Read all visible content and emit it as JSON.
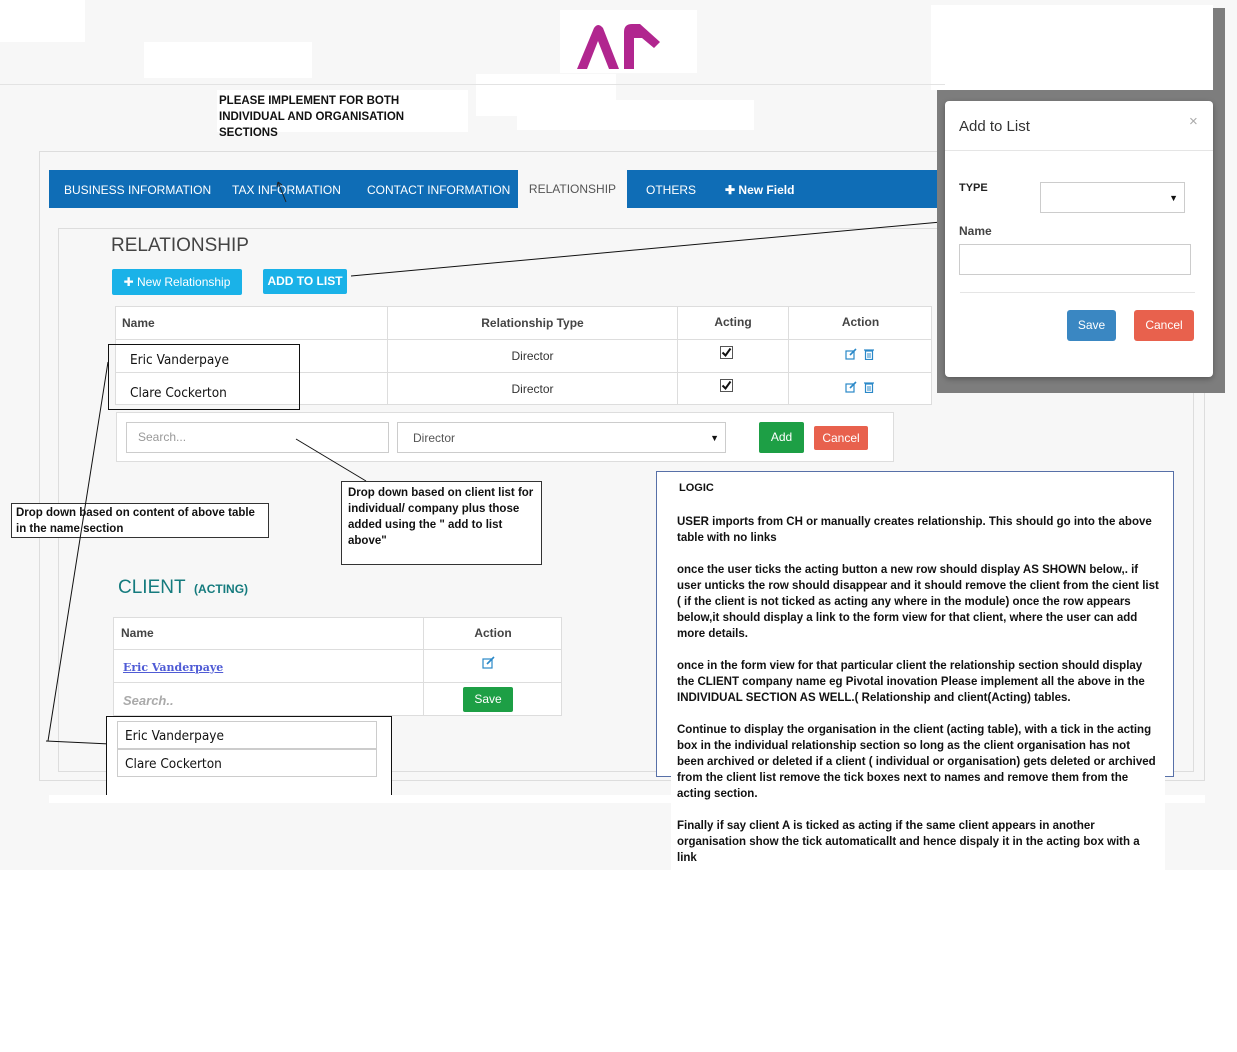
{
  "colors": {
    "nav_bg": "#0f6db6",
    "cyan_button": "#1ab2e8",
    "green": "#1d9f45",
    "red_cancel": "#e8614d",
    "save_blue": "#3a87c2",
    "client_heading": "#157b7e",
    "logo": "#b1268f",
    "link": "#4f5bd5"
  },
  "logo": {
    "alt": "AP"
  },
  "top_note": "PLEASE IMPLEMENT FOR BOTH INDIVIDUAL AND ORGANISATION SECTIONS",
  "tabs": [
    {
      "label": "BUSINESS INFORMATION"
    },
    {
      "label": "TAX INFORMATION"
    },
    {
      "label": "CONTACT INFORMATION"
    },
    {
      "label": "RELATIONSHIP"
    },
    {
      "label": "OTHERS"
    },
    {
      "label": "New Field",
      "icon": "plus-icon"
    }
  ],
  "relationship": {
    "title": "RELATIONSHIP",
    "new_button": "New Relationship",
    "add_list_button": "ADD TO LIST",
    "columns": [
      "Name",
      "Relationship Type",
      "Acting",
      "Action"
    ],
    "rows": [
      {
        "name": "Eric Vanderpaye",
        "type": "Director",
        "acting": true
      },
      {
        "name": "Clare Cockerton",
        "type": "Director",
        "acting": true
      }
    ],
    "add_row": {
      "search_placeholder": "Search...",
      "type_value": "Director",
      "add_label": "Add",
      "cancel_label": "Cancel"
    }
  },
  "notes": {
    "dropdown_name": "Drop down based on content of above table in the name section",
    "dropdown_client": "Drop down based on client list for individual/ company plus those added using the \" add to list above\""
  },
  "client": {
    "title": "CLIENT",
    "subtitle": "(ACTING)",
    "columns": [
      "Name",
      "Action"
    ],
    "rows": [
      {
        "name": "Eric Vanderpaye"
      }
    ],
    "search_placeholder": "Search..",
    "save_label": "Save",
    "dropdown_options": [
      "Eric Vanderpaye",
      "Clare Cockerton"
    ]
  },
  "modal": {
    "title": "Add to List",
    "close": "×",
    "type_label": "TYPE",
    "type_value": "",
    "name_label": "Name",
    "name_value": "",
    "save_label": "Save",
    "cancel_label": "Cancel"
  },
  "logic": {
    "heading": "LOGIC",
    "paragraphs": [
      "USER imports from CH or manually creates relationship. This should go into the above table with no links",
      "once the user ticks the acting button a new row should display AS SHOWN below,. if user unticks the row should disappear and it should remove the client from the cient list ( if the client is not ticked as acting any where in the module) once the row appears below,it should display a link to the form view for that client, where the user can add more details.",
      "once in the form view for that particular client the relationship section should display the CLIENT company name eg Pivotal inovation Please implement all the above in the INDIVIDUAL SECTION AS WELL.( Relationship and client(Acting) tables.",
      "Continue to display the organisation in the client (acting table), with a tick in the acting box in the individual relationship section so long as the client organisation has not been archived or deleted  if a client ( individual or organisation) gets deleted or archived from the client list  remove the tick boxes next to names and remove them from the acting section.",
      "Finally if say client A is ticked as acting if the same client appears in another organisation show the tick automaticallt and hence dispaly it in the acting box with a link"
    ]
  }
}
